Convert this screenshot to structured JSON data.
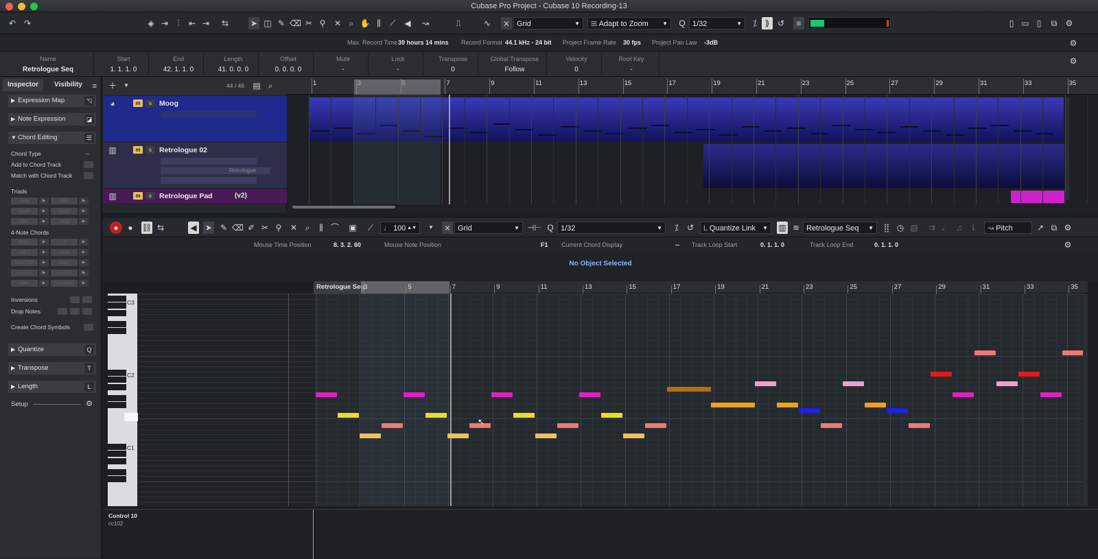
{
  "window": {
    "title": "Cubase Pro Project - Cubase 10 Recording-13"
  },
  "toolbar": {
    "grid_mode": "Grid",
    "zoom_mode": "Adapt to Zoom",
    "quantize": "1/32"
  },
  "status_line": {
    "max_record_time_label": "Max. Record Time",
    "max_record_time_value": "39 hours 14 mins",
    "record_format_label": "Record Format",
    "record_format_value": "44.1 kHz - 24 bit",
    "frame_rate_label": "Project Frame Rate",
    "frame_rate_value": "30 fps",
    "pan_law_label": "Project Pan Law",
    "pan_law_value": "-3dB"
  },
  "info_line": {
    "headers": [
      "Name",
      "Start",
      "End",
      "Length",
      "Offset",
      "Mute",
      "Lock",
      "Transpose",
      "Global Transpose",
      "Velocity",
      "Root Key"
    ],
    "values": [
      "Retrologue Seq",
      "1. 1. 1. 0",
      "42. 1. 1. 0",
      "41. 0. 0. 0",
      "0. 0. 0. 0",
      "-",
      "-",
      "0",
      "Follow",
      "0",
      "-"
    ]
  },
  "inspector": {
    "tabs": [
      "Inspector",
      "Visibility"
    ],
    "sections": {
      "expression_map": "Expression Map",
      "note_expression": "Note Expression",
      "chord_editing": "Chord Editing",
      "quantize": "Quantize",
      "transpose": "Transpose",
      "length": "Length"
    },
    "chord_editing": {
      "chord_type": "Chord Type",
      "chord_type_value": "--",
      "add_to_chord_track": "Add to Chord Track",
      "match_with_chord_track": "Match with Chord Track",
      "triads": "Triads",
      "triad_buttons": [
        "maj",
        "min",
        "sus4",
        "sus2",
        "dim",
        "aug"
      ],
      "four_note": "4-Note Chords",
      "four_note_buttons": [
        "maj7",
        "7",
        "min7",
        "min6",
        "min7/b5",
        "minj7",
        "sus4/7",
        "sus2/7",
        "dim",
        "maj7/#5"
      ],
      "inversions": "Inversions",
      "drop_notes": "Drop Notes",
      "create_chord_symbols": "Create Chord Symbols"
    },
    "setup": "Setup"
  },
  "project": {
    "track_count": "44 / 46",
    "ruler": [
      "1",
      "3",
      "5",
      "7",
      "9",
      "11",
      "13",
      "15",
      "17",
      "19",
      "21",
      "23",
      "25",
      "27",
      "29",
      "31",
      "33",
      "35"
    ],
    "tracks": [
      {
        "name": "Moog"
      },
      {
        "name": "Retrologue 02",
        "instrument": "Retrologue"
      },
      {
        "name": "Retrologue Pad",
        "version": "(v2)"
      }
    ]
  },
  "editor": {
    "velocity": "100",
    "grid_mode": "Grid",
    "quantize": "1/32",
    "quantize_link": "Quantize Link",
    "part": "Retrologue Seq",
    "pitch": "Pitch",
    "mouse_time_label": "Mouse Time Position",
    "mouse_time_value": "8. 3. 2. 60",
    "mouse_note_label": "Mouse Note Position",
    "mouse_note_value": "F1",
    "chord_display_label": "Current Chord Display",
    "chord_display_value": "--",
    "loop_start_label": "Track Loop Start",
    "loop_start_value": "0. 1. 1. 0",
    "loop_end_label": "Track Loop End",
    "loop_end_value": "0. 1. 1. 0",
    "no_object": "No Object Selected",
    "ruler_part_label": "Retrologue Seq",
    "ruler": [
      "3",
      "5",
      "7",
      "9",
      "11",
      "13",
      "15",
      "17",
      "19",
      "21",
      "23",
      "25",
      "27",
      "29",
      "31",
      "33",
      "35"
    ],
    "keys": [
      "C3",
      "C2",
      "C1"
    ],
    "controller": "Control 10",
    "controller_sub": "cc102"
  },
  "colors": {
    "magenta": "#e020c0",
    "yellow": "#e8e020",
    "peach": "#f0c060",
    "salmon": "#f07878",
    "orange": "#f0a020",
    "blue": "#2020e0",
    "pink": "#f0a0d0",
    "red": "#e81818",
    "dark_orange": "#b07010"
  }
}
